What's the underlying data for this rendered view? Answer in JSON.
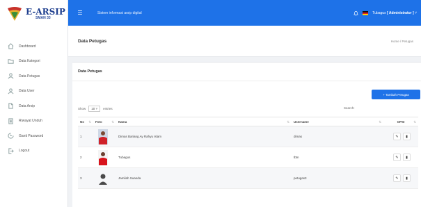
{
  "brand": {
    "title": "E-ARSIP",
    "subtitle": "SMAN 33"
  },
  "sidebar": {
    "items": [
      {
        "label": "Dashboard",
        "icon": "home-icon"
      },
      {
        "label": "Data Kategori",
        "icon": "folder-icon"
      },
      {
        "label": "Data Petugas",
        "icon": "user-icon"
      },
      {
        "label": "Data User",
        "icon": "user-icon"
      },
      {
        "label": "Data Arsip",
        "icon": "file-icon"
      },
      {
        "label": "Riwayat Unduh",
        "icon": "list-icon"
      },
      {
        "label": "Ganti Password",
        "icon": "lock-icon"
      },
      {
        "label": "Logout",
        "icon": "logout-icon"
      }
    ]
  },
  "topbar": {
    "title": "Sistem informasi arsip digital",
    "user_name": "Tubagus",
    "user_role": "[ Administrator ]"
  },
  "page": {
    "title": "Data Petugas",
    "breadcrumb": "Home / Petugas"
  },
  "card": {
    "title": "Data Petugas",
    "add_button": "+ Tambah Petugas",
    "show_label": "Show",
    "entries_value": "10",
    "entries_label": "entries",
    "search_label": "Search:"
  },
  "table": {
    "headers": [
      "No",
      "Foto",
      "Nama",
      "Username",
      "OPSI"
    ],
    "rows": [
      {
        "no": "1",
        "nama": "Dimas Bariang Ay Rahyu Islam",
        "username": "dimas",
        "photo": "red-shirt"
      },
      {
        "no": "2",
        "nama": "Tubagus",
        "username": "tbtn",
        "photo": "red-shirt"
      },
      {
        "no": "3",
        "nama": "Jamilah Suanda",
        "username": "petugas3",
        "photo": "avatar"
      }
    ]
  },
  "colors": {
    "accent": "#1e72e8"
  }
}
